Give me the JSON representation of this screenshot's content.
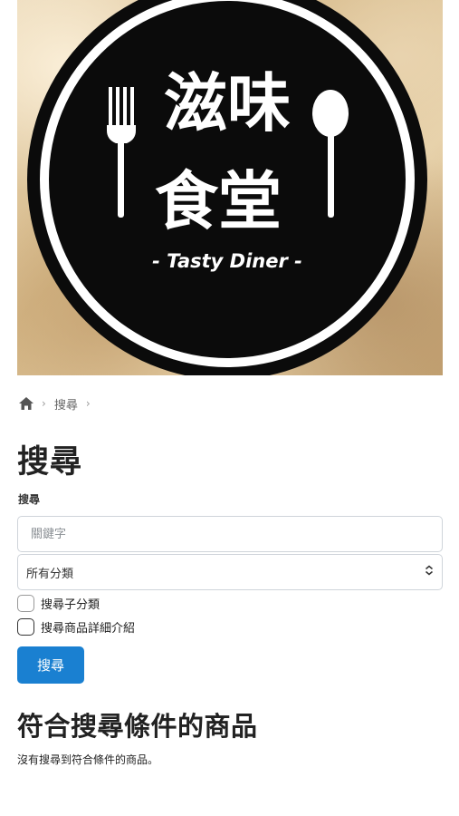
{
  "logo": {
    "title_line1": "滋味",
    "title_line2": "食堂",
    "subtitle": "- Tasty Diner -"
  },
  "breadcrumb": {
    "home_icon": "home-icon",
    "items": [
      "搜尋"
    ]
  },
  "page": {
    "title": "搜尋",
    "field_label": "搜尋"
  },
  "search": {
    "placeholder": "關鍵字",
    "value": ""
  },
  "category": {
    "selected": "所有分類"
  },
  "options": {
    "subcategory_label": "搜尋子分類",
    "description_label": "搜尋商品詳細介紹"
  },
  "actions": {
    "search_button": "搜尋"
  },
  "results": {
    "heading": "符合搜尋條件的商品",
    "empty_message": "沒有搜尋到符合條件的商品。"
  },
  "colors": {
    "primary": "#1a80d1",
    "logo_dark": "#0b0b0b",
    "logo_light": "#ffffff"
  }
}
